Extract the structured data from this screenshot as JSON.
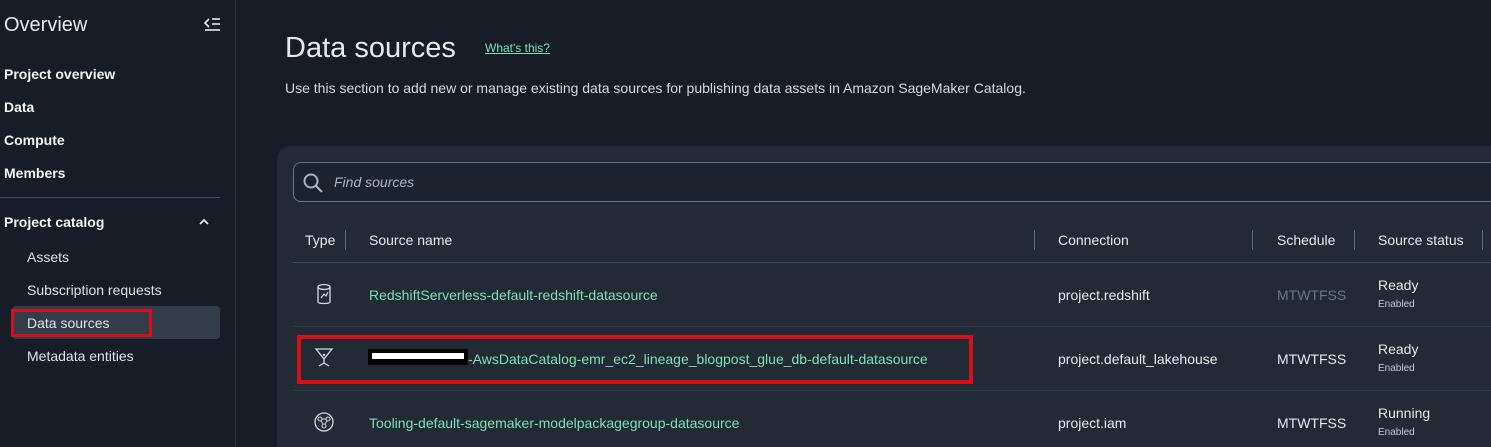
{
  "sidebar": {
    "title": "Overview",
    "collapse_icon": "collapse-menu-icon",
    "items": [
      {
        "label": "Project overview"
      },
      {
        "label": "Data"
      },
      {
        "label": "Compute"
      },
      {
        "label": "Members"
      }
    ],
    "group": {
      "label": "Project catalog",
      "icon": "chevron-up-icon",
      "sub_items": [
        {
          "label": "Assets"
        },
        {
          "label": "Subscription requests"
        },
        {
          "label": "Data sources"
        },
        {
          "label": "Metadata entities"
        }
      ]
    }
  },
  "main": {
    "title": "Data sources",
    "whats_this": "What's this?",
    "description": "Use this section to add new or manage existing data sources for publishing data assets in Amazon SageMaker Catalog.",
    "search": {
      "placeholder": "Find sources",
      "value": ""
    },
    "table": {
      "headers": [
        "Type",
        "Source name",
        "Connection",
        "Schedule",
        "Source status"
      ],
      "rows": [
        {
          "type_icon": "redshift-database-icon",
          "name": "RedshiftServerless-default-redshift-datasource",
          "connection": "project.redshift",
          "schedule": "MTWTFSS",
          "status": "Ready",
          "status_sub": "Enabled"
        },
        {
          "type_icon": "glue-catalog-icon",
          "name": "-AwsDataCatalog-emr_ec2_lineage_blogpost_glue_db-default-datasource",
          "connection": "project.default_lakehouse",
          "schedule": "MTWTFSS",
          "status": "Ready",
          "status_sub": "Enabled"
        },
        {
          "type_icon": "sagemaker-brain-icon",
          "name": "Tooling-default-sagemaker-modelpackagegroup-datasource",
          "connection": "project.iam",
          "schedule": "MTWTFSS",
          "status": "Running",
          "status_sub": "Enabled"
        }
      ]
    }
  },
  "colors": {
    "accent_link": "#7ee0b6",
    "highlight_red": "#d5101a",
    "background": "#161d26",
    "panel": "#212a35"
  }
}
